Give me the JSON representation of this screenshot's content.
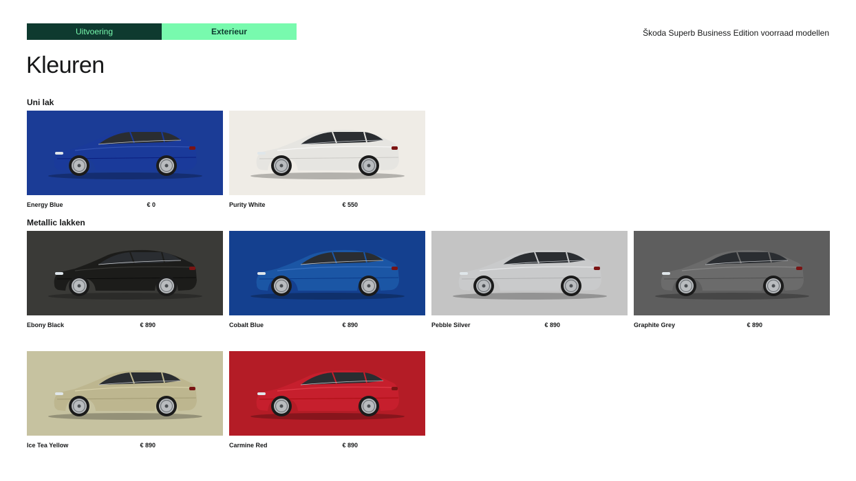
{
  "tabs": [
    {
      "label": "Uitvoering"
    },
    {
      "label": "Exterieur"
    }
  ],
  "document_title": "Škoda Superb Business Edition voorraad modellen",
  "heading": "Kleuren",
  "sections": [
    {
      "title": "Uni lak",
      "colors": [
        {
          "name": "Energy Blue",
          "price": "€ 0",
          "paint": "#1a3a9a",
          "background": "#1b3c96"
        },
        {
          "name": "Purity White",
          "price": "€ 550",
          "paint": "#e6e5e1",
          "background": "#efece6"
        }
      ]
    },
    {
      "title": "Metallic lakken",
      "colors": [
        {
          "name": "Ebony Black",
          "price": "€ 890",
          "paint": "#1c1c1a",
          "background": "#3a3a37"
        },
        {
          "name": "Cobalt Blue",
          "price": "€ 890",
          "paint": "#1b56a5",
          "background": "#14408f"
        },
        {
          "name": "Pebble Silver",
          "price": "€ 890",
          "paint": "#c9cacb",
          "background": "#c4c4c4"
        },
        {
          "name": "Graphite Grey",
          "price": "€ 890",
          "paint": "#6b6b6b",
          "background": "#5e5e5e"
        },
        {
          "name": "Ice Tea Yellow",
          "price": "€ 890",
          "paint": "#bdb68f",
          "background": "#c6c2a0"
        },
        {
          "name": "Carmine Red",
          "price": "€ 890",
          "paint": "#c61f2d",
          "background": "#b41c26"
        }
      ]
    }
  ]
}
